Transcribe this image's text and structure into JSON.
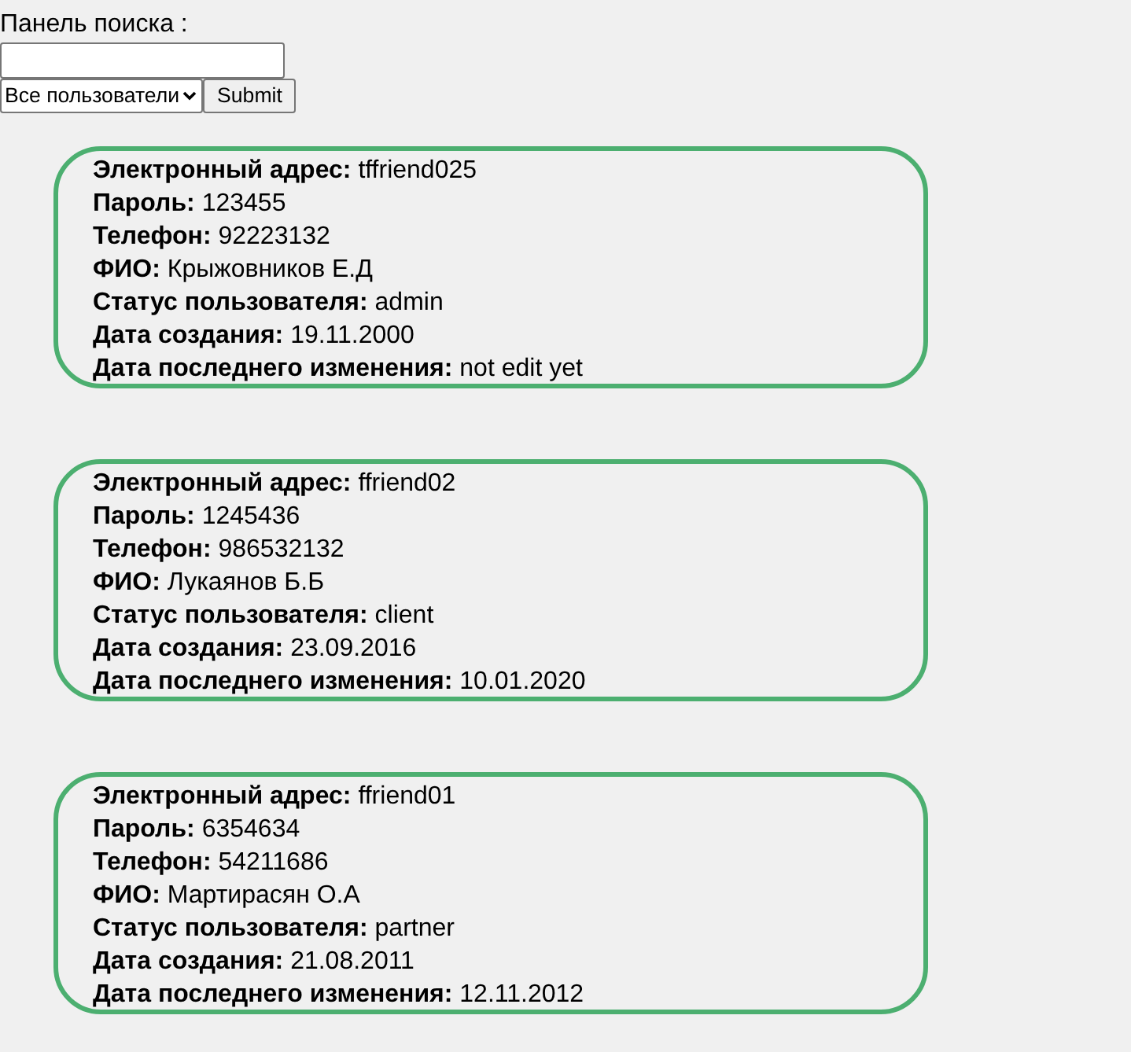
{
  "search_panel": {
    "label": "Панель поиска :",
    "filter": {
      "value": "Все пользователи"
    },
    "submit": "Submit"
  },
  "records": [
    {
      "fields": [
        {
          "label": "Электронный адрес:",
          "value": "tffriend025"
        },
        {
          "label": "Пароль:",
          "value": "123455"
        },
        {
          "label": "Телефон:",
          "value": "92223132"
        },
        {
          "label": "ФИО:",
          "value": "Крыжовников Е.Д"
        },
        {
          "label": "Статус пользователя:",
          "value": "admin"
        },
        {
          "label": "Дата создания:",
          "value": "19.11.2000"
        },
        {
          "label": "Дата последнего изменения:",
          "value": "not edit yet"
        }
      ]
    },
    {
      "fields": [
        {
          "label": "Электронный адрес:",
          "value": "ffriend02"
        },
        {
          "label": "Пароль:",
          "value": "1245436"
        },
        {
          "label": "Телефон:",
          "value": "986532132"
        },
        {
          "label": "ФИО:",
          "value": "Лукаянов Б.Б"
        },
        {
          "label": "Статус пользователя:",
          "value": "client"
        },
        {
          "label": "Дата создания:",
          "value": "23.09.2016"
        },
        {
          "label": "Дата последнего изменения:",
          "value": "10.01.2020"
        }
      ]
    },
    {
      "fields": [
        {
          "label": "Электронный адрес:",
          "value": "ffriend01"
        },
        {
          "label": "Пароль:",
          "value": "6354634"
        },
        {
          "label": "Телефон:",
          "value": "54211686"
        },
        {
          "label": "ФИО:",
          "value": "Мартирасян О.А"
        },
        {
          "label": "Статус пользователя:",
          "value": "partner"
        },
        {
          "label": "Дата создания:",
          "value": "21.08.2011"
        },
        {
          "label": "Дата последнего изменения:",
          "value": "12.11.2012"
        }
      ]
    }
  ]
}
